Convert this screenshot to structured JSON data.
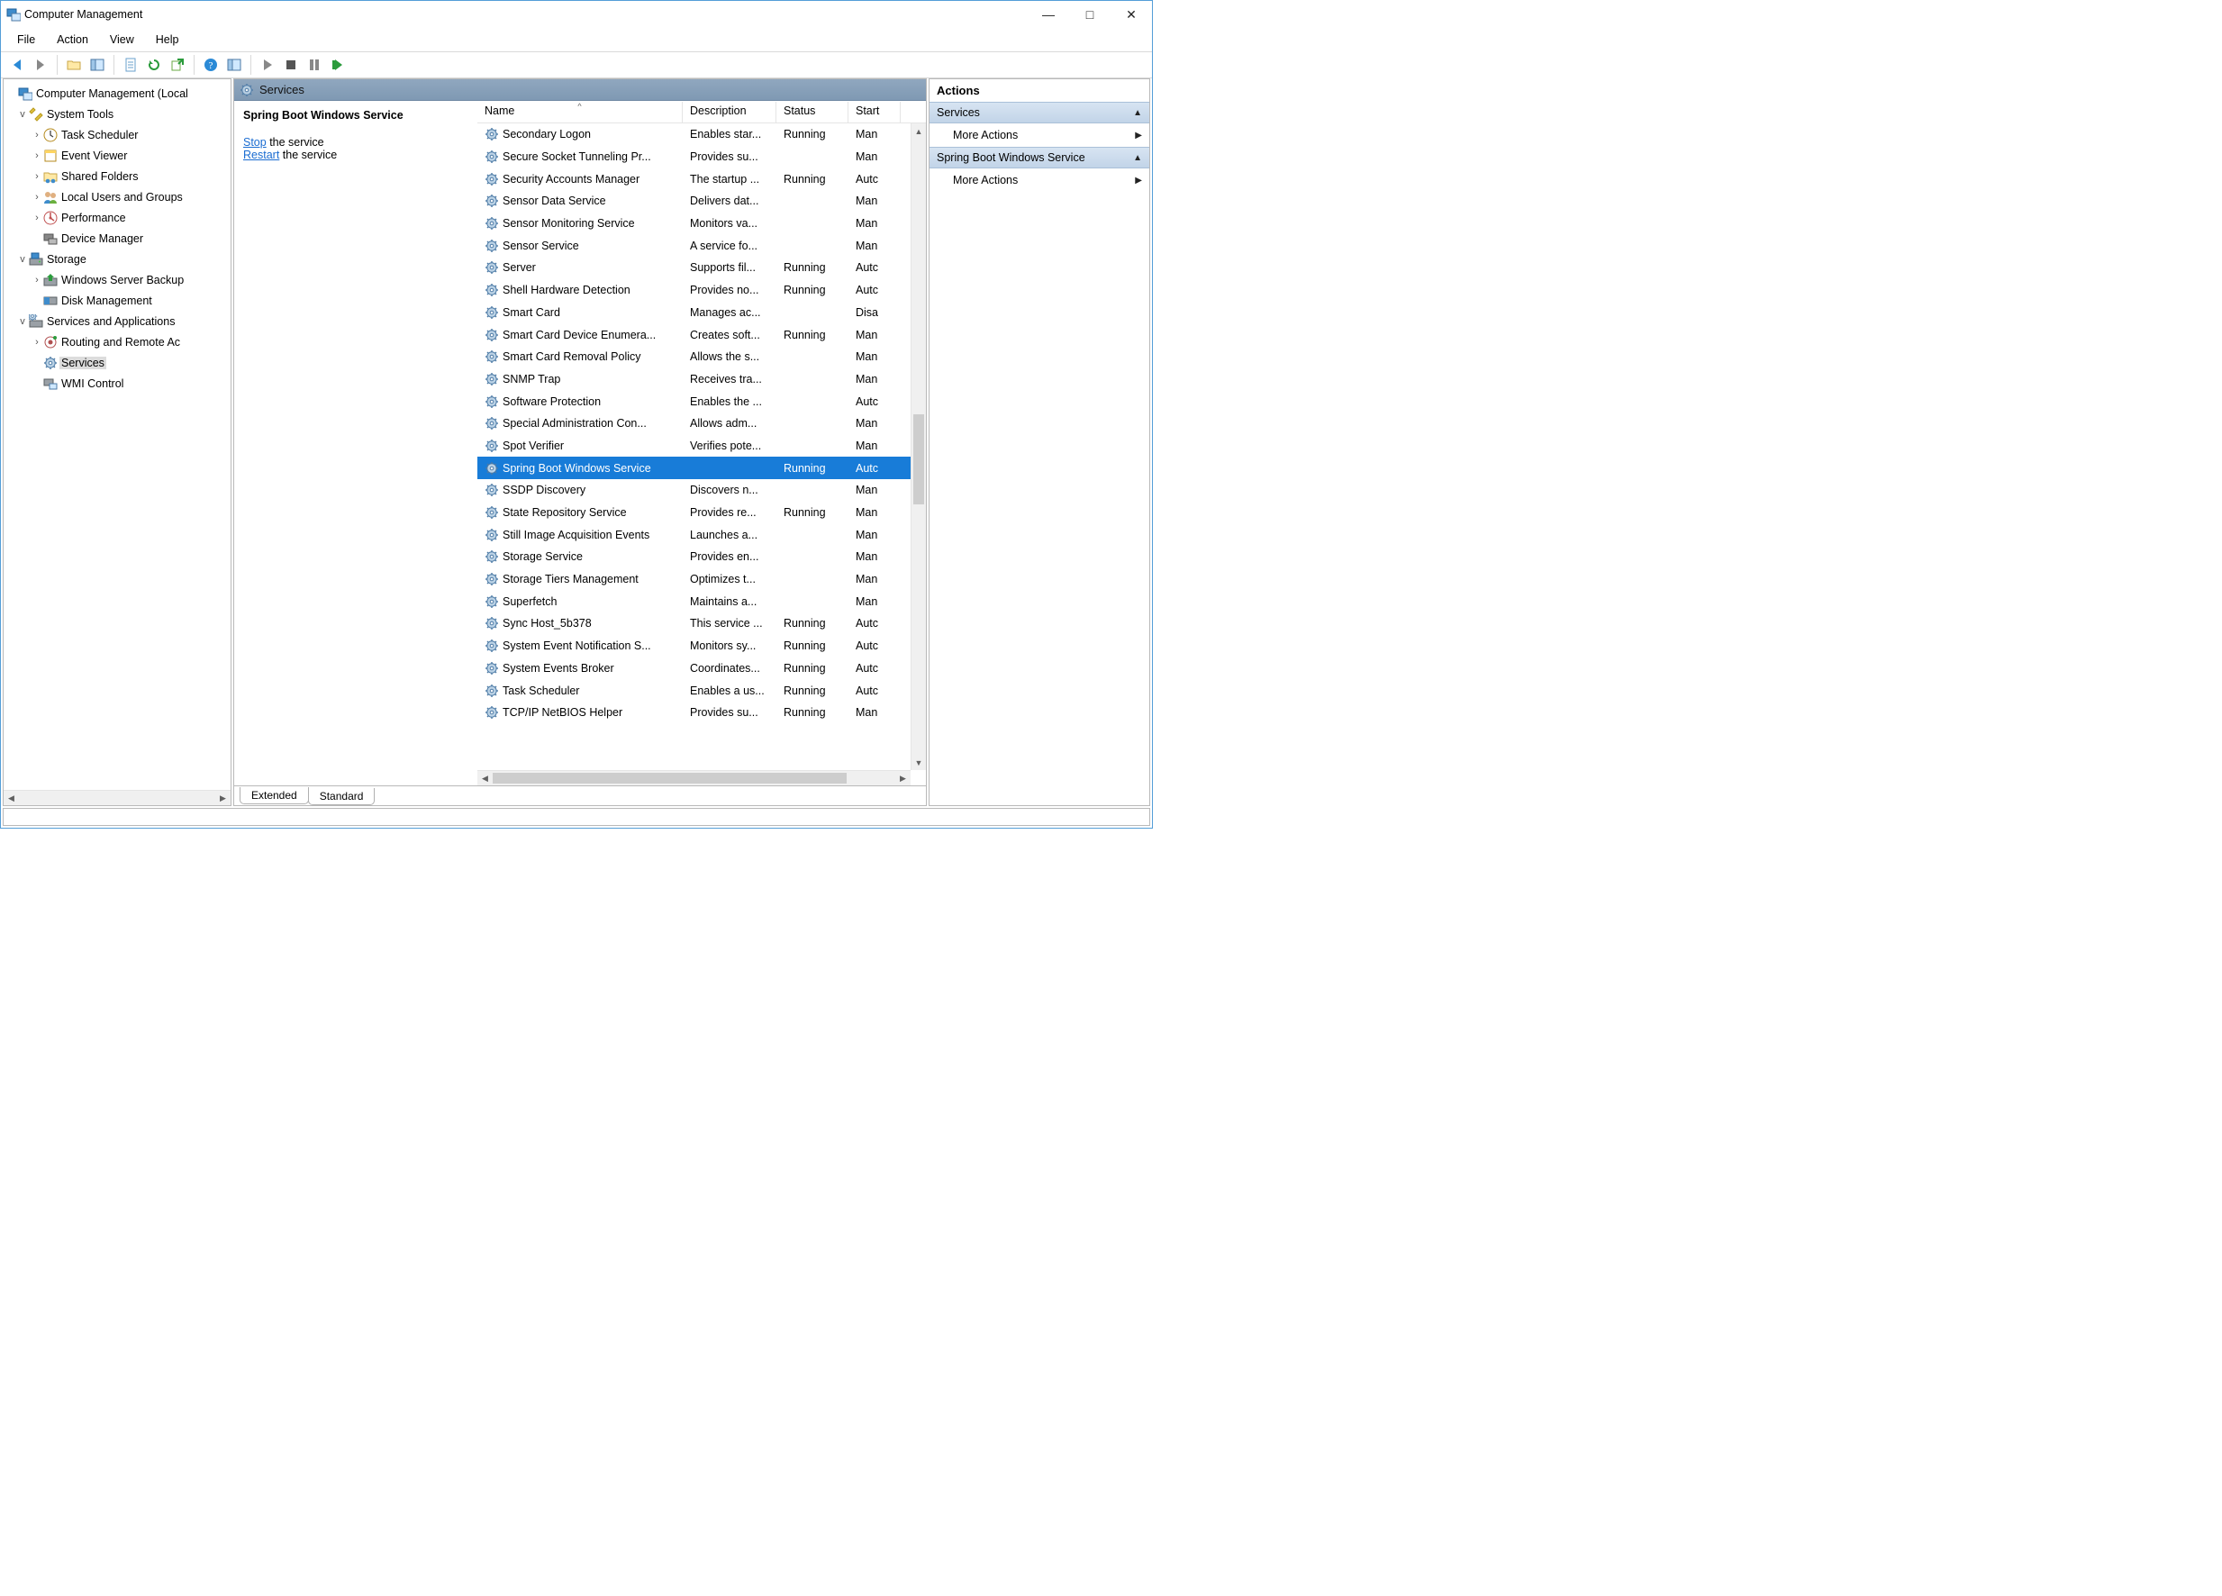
{
  "window": {
    "title": "Computer Management"
  },
  "menu": {
    "file": "File",
    "action": "Action",
    "view": "View",
    "help": "Help"
  },
  "toolbar_icons": [
    "back",
    "forward",
    "up",
    "props",
    "screen",
    "refresh",
    "export",
    "help2",
    "services-panel",
    "start",
    "stop",
    "pause",
    "restart"
  ],
  "tree": {
    "root": "Computer Management (Local",
    "system_tools": "System Tools",
    "system_children": {
      "task_scheduler": "Task Scheduler",
      "event_viewer": "Event Viewer",
      "shared_folders": "Shared Folders",
      "local_users": "Local Users and Groups",
      "performance": "Performance",
      "device_manager": "Device Manager"
    },
    "storage": "Storage",
    "storage_children": {
      "wsb": "Windows Server Backup",
      "disk": "Disk Management"
    },
    "sva": "Services and Applications",
    "sva_children": {
      "routing": "Routing and Remote Ac",
      "services": "Services",
      "wmi": "WMI Control"
    }
  },
  "center": {
    "header": "Services",
    "selected_service": "Spring Boot Windows Service",
    "stop_label": "Stop",
    "restart_label": "Restart",
    "the_service": " the service",
    "columns": {
      "name": "Name",
      "desc": "Description",
      "status": "Status",
      "startup": "Start"
    },
    "col_widths": {
      "name": 228,
      "desc": 104,
      "status": 80,
      "startup": 58
    },
    "rows": [
      {
        "name": "Secondary Logon",
        "desc": "Enables star...",
        "status": "Running",
        "startup": "Man"
      },
      {
        "name": "Secure Socket Tunneling Pr...",
        "desc": "Provides su...",
        "status": "",
        "startup": "Man"
      },
      {
        "name": "Security Accounts Manager",
        "desc": "The startup ...",
        "status": "Running",
        "startup": "Autc"
      },
      {
        "name": "Sensor Data Service",
        "desc": "Delivers dat...",
        "status": "",
        "startup": "Man"
      },
      {
        "name": "Sensor Monitoring Service",
        "desc": "Monitors va...",
        "status": "",
        "startup": "Man"
      },
      {
        "name": "Sensor Service",
        "desc": "A service fo...",
        "status": "",
        "startup": "Man"
      },
      {
        "name": "Server",
        "desc": "Supports fil...",
        "status": "Running",
        "startup": "Autc"
      },
      {
        "name": "Shell Hardware Detection",
        "desc": "Provides no...",
        "status": "Running",
        "startup": "Autc"
      },
      {
        "name": "Smart Card",
        "desc": "Manages ac...",
        "status": "",
        "startup": "Disa"
      },
      {
        "name": "Smart Card Device Enumera...",
        "desc": "Creates soft...",
        "status": "Running",
        "startup": "Man"
      },
      {
        "name": "Smart Card Removal Policy",
        "desc": "Allows the s...",
        "status": "",
        "startup": "Man"
      },
      {
        "name": "SNMP Trap",
        "desc": "Receives tra...",
        "status": "",
        "startup": "Man"
      },
      {
        "name": "Software Protection",
        "desc": "Enables the ...",
        "status": "",
        "startup": "Autc"
      },
      {
        "name": "Special Administration Con...",
        "desc": "Allows adm...",
        "status": "",
        "startup": "Man"
      },
      {
        "name": "Spot Verifier",
        "desc": "Verifies pote...",
        "status": "",
        "startup": "Man"
      },
      {
        "name": "Spring Boot Windows Service",
        "desc": "",
        "status": "Running",
        "startup": "Autc",
        "selected": true
      },
      {
        "name": "SSDP Discovery",
        "desc": "Discovers n...",
        "status": "",
        "startup": "Man"
      },
      {
        "name": "State Repository Service",
        "desc": "Provides re...",
        "status": "Running",
        "startup": "Man"
      },
      {
        "name": "Still Image Acquisition Events",
        "desc": "Launches a...",
        "status": "",
        "startup": "Man"
      },
      {
        "name": "Storage Service",
        "desc": "Provides en...",
        "status": "",
        "startup": "Man"
      },
      {
        "name": "Storage Tiers Management",
        "desc": "Optimizes t...",
        "status": "",
        "startup": "Man"
      },
      {
        "name": "Superfetch",
        "desc": "Maintains a...",
        "status": "",
        "startup": "Man"
      },
      {
        "name": "Sync Host_5b378",
        "desc": "This service ...",
        "status": "Running",
        "startup": "Autc"
      },
      {
        "name": "System Event Notification S...",
        "desc": "Monitors sy...",
        "status": "Running",
        "startup": "Autc"
      },
      {
        "name": "System Events Broker",
        "desc": "Coordinates...",
        "status": "Running",
        "startup": "Autc"
      },
      {
        "name": "Task Scheduler",
        "desc": "Enables a us...",
        "status": "Running",
        "startup": "Autc"
      },
      {
        "name": "TCP/IP NetBIOS Helper",
        "desc": "Provides su...",
        "status": "Running",
        "startup": "Man"
      }
    ],
    "tabs": {
      "extended": "Extended",
      "standard": "Standard"
    }
  },
  "actions": {
    "header": "Actions",
    "section_services": "Services",
    "more_actions": "More Actions",
    "section_selected": "Spring Boot Windows Service"
  }
}
